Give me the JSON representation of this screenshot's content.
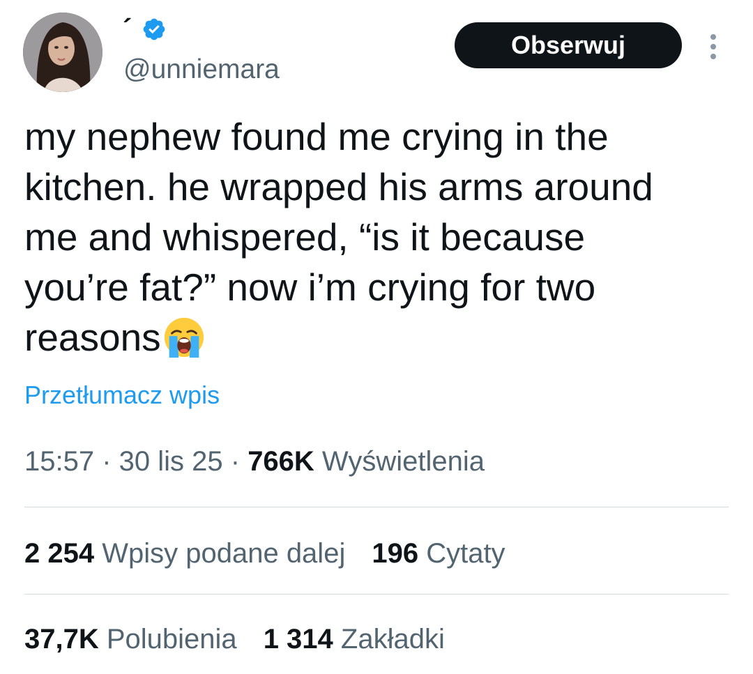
{
  "author": {
    "display_name": "´",
    "handle": "@unniemara",
    "verified_icon": "verified-badge-icon",
    "verified_color": "#1d9bf0"
  },
  "follow_button": {
    "label": "Obserwuj"
  },
  "more_icon": "more-vertical-icon",
  "tweet": {
    "lines": [
      "my nephew found me crying in the",
      "kitchen. he wrapped his arms around",
      "me and whispered, “is it because",
      "you’re fat?” now i’m crying for two",
      "reasons"
    ],
    "emoji": "loudly-crying-face-emoji"
  },
  "translate_link": "Przetłumacz wpis",
  "meta": {
    "time": "15:57",
    "sep1": " · ",
    "date": "30 lis 25",
    "sep2": " · ",
    "views_count": "766K",
    "views_label": " Wyświetlenia"
  },
  "stats": {
    "reposts_count": "2 254",
    "reposts_label": " Wpisy podane dalej",
    "quotes_count": "196",
    "quotes_label": " Cytaty",
    "likes_count": "37,7K",
    "likes_label": " Polubienia",
    "bookmarks_count": "1 314",
    "bookmarks_label": " Zakładki"
  },
  "colors": {
    "text": "#0f1419",
    "secondary": "#536471",
    "link": "#1d9bf0",
    "divider": "#cfd9de",
    "button_bg": "#0f1419"
  }
}
